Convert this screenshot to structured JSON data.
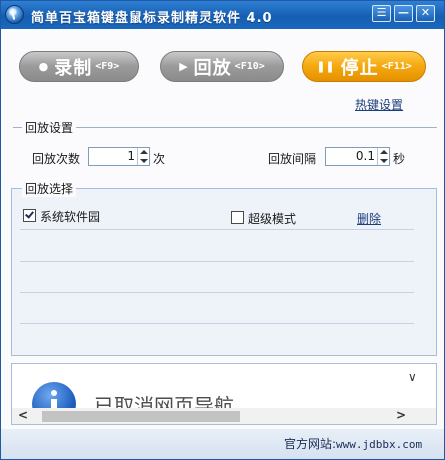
{
  "window": {
    "title": "简单百宝箱键盘鼠标录制精灵软件 4.0"
  },
  "titlebar": {
    "menu_glyph": "☰",
    "minimize_glyph": "—",
    "close_glyph": "✕"
  },
  "actions": {
    "record": {
      "label": "录制",
      "key": "<F9>",
      "icon": "record-dot-icon"
    },
    "replay": {
      "label": "回放",
      "key": "<F10>",
      "icon": "play-icon"
    },
    "stop": {
      "label": "停止",
      "key": "<F11>",
      "icon": "pause-icon"
    }
  },
  "hotkey_settings_link": "热键设置",
  "playback_settings": {
    "title": "回放设置",
    "count_label": "回放次数",
    "count_value": "1",
    "count_unit": "次",
    "interval_label": "回放间隔",
    "interval_value": "0.1",
    "interval_unit": "秒"
  },
  "playback_selection": {
    "title": "回放选择",
    "item_label": "系统软件园",
    "item_checked": true,
    "super_mode_label": "超级模式",
    "super_mode_checked": false,
    "delete_label": "删除"
  },
  "info_pane": {
    "message": "已取消网页导航"
  },
  "footer": {
    "label": "官方网站:",
    "url": "www.jdbbx.com"
  },
  "colors": {
    "title_bar": "#1a67bd",
    "stop_button": "#f4a80f",
    "gray_button": "#9a9a9a",
    "link": "#1c3d7a"
  }
}
